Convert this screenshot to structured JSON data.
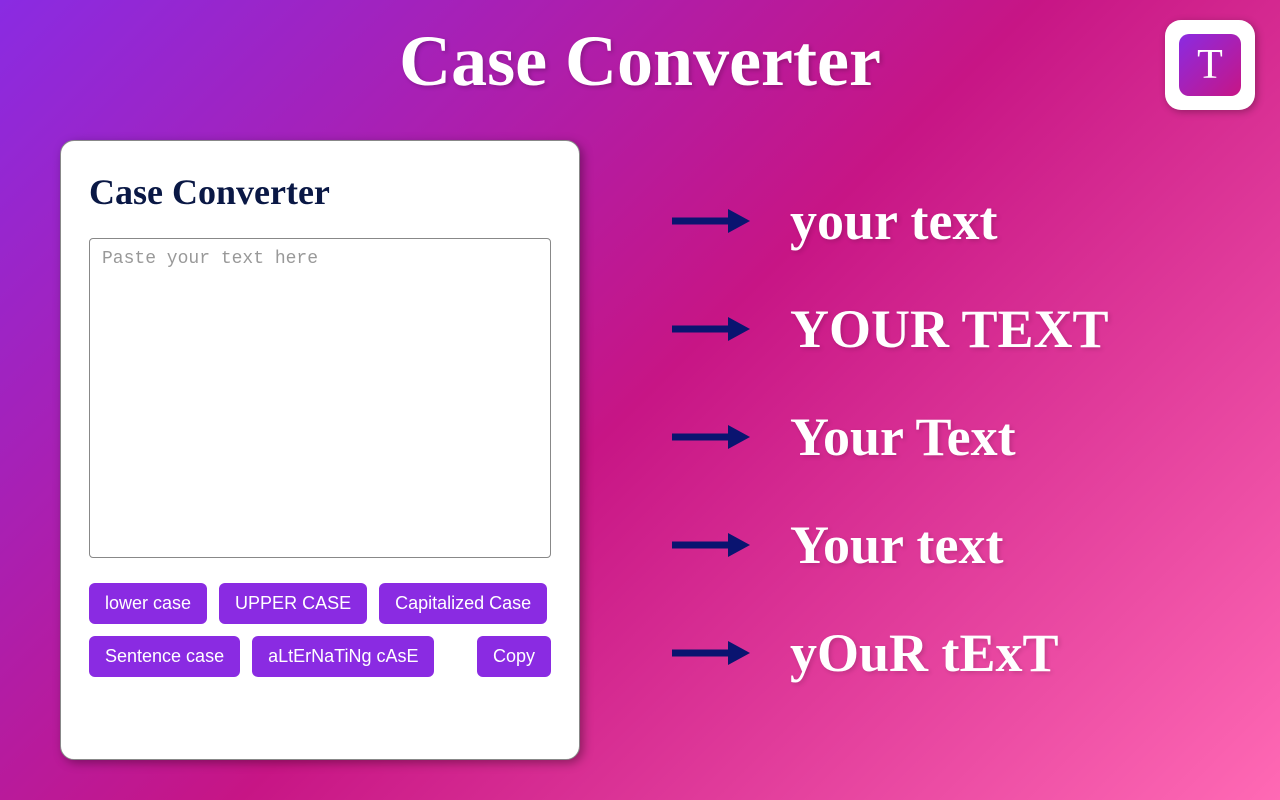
{
  "title": "Case Converter",
  "icon_letter": "T",
  "card": {
    "title": "Case Converter",
    "placeholder": "Paste your text here"
  },
  "buttons": {
    "lower": "lower case",
    "upper": "UPPER CASE",
    "capitalized": "Capitalized Case",
    "sentence": "Sentence case",
    "alternating": "aLtErNaTiNg cAsE",
    "copy": "Copy"
  },
  "examples": [
    "your text",
    "YOUR TEXT",
    "Your Text",
    "Your text",
    "yOuR tExT"
  ]
}
